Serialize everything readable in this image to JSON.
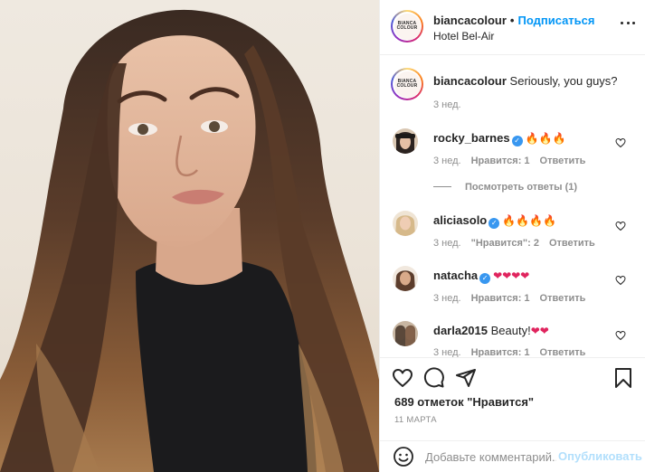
{
  "header": {
    "avatar_text": "BIANCA COLOUR",
    "username": "biancacolour",
    "dot": "•",
    "follow_label": "Подписаться",
    "location": "Hotel Bel-Air",
    "more_icon": "more-horizontal-icon"
  },
  "caption": {
    "username": "biancacolour",
    "text": "Seriously, you guys?",
    "time": "3 нед."
  },
  "comments": [
    {
      "username": "rocky_barnes",
      "verified": true,
      "text": "",
      "emoji": "🔥🔥🔥",
      "time": "3 нед.",
      "likes": "Нравится: 1",
      "reply": "Ответить",
      "view_replies": "Посмотреть ответы (1)"
    },
    {
      "username": "aliciasolo",
      "verified": true,
      "text": "",
      "emoji": "🔥🔥🔥🔥",
      "time": "3 нед.",
      "likes": "\"Нравится\": 2",
      "reply": "Ответить"
    },
    {
      "username": "natacha",
      "verified": true,
      "text": "",
      "emoji": "❤❤❤❤",
      "time": "3 нед.",
      "likes": "Нравится: 1",
      "reply": "Ответить"
    },
    {
      "username": "darla2015",
      "verified": false,
      "text": "Beauty!",
      "emoji": "❤❤",
      "time": "3 нед.",
      "likes": "Нравится: 1",
      "reply": "Ответить"
    }
  ],
  "actions": {
    "icons": [
      "heart-icon",
      "comment-icon",
      "share-icon",
      "bookmark-icon"
    ],
    "likes": "689 отметок \"Нравится\"",
    "date": "11 МАРТА"
  },
  "add_comment": {
    "placeholder": "Добавьте комментарий...",
    "publish_label": "Опубликовать"
  },
  "colors": {
    "accent": "#0095f6",
    "verified": "#3897f0",
    "muted": "#8e8e8e",
    "publish_disabled": "#b2dffc"
  }
}
